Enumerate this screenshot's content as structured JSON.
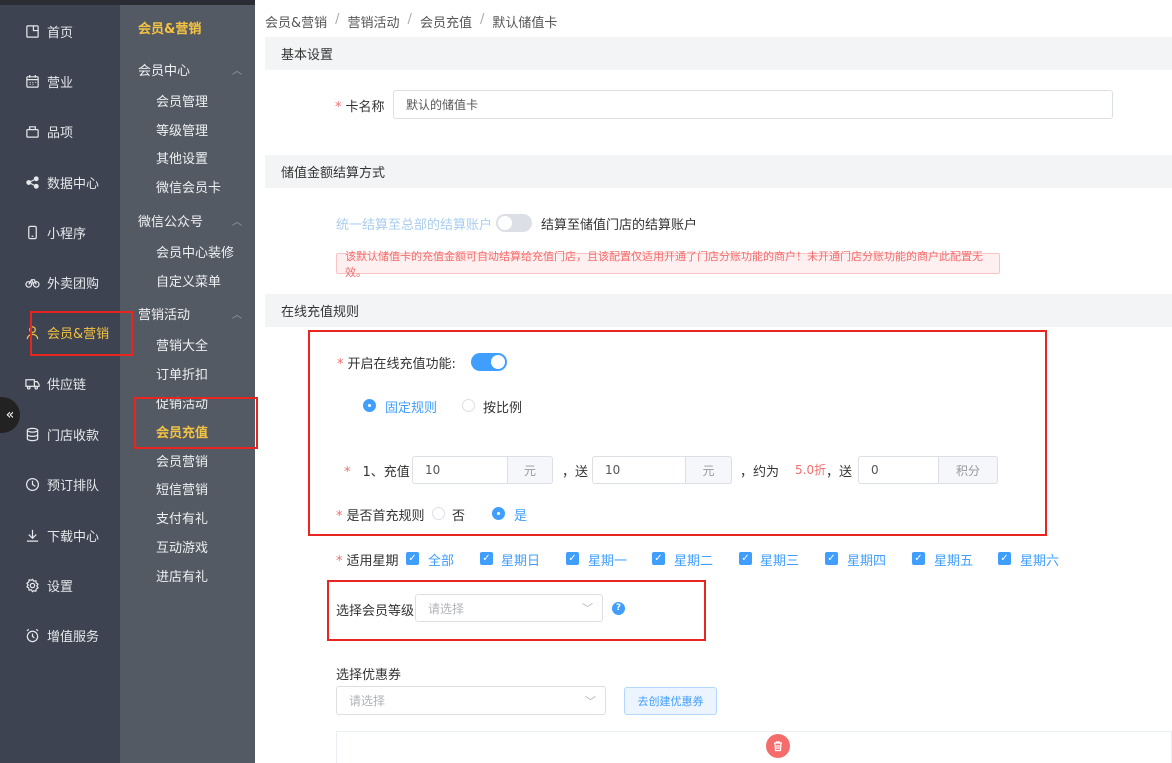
{
  "nav_primary": [
    {
      "label": "首页",
      "icon": "home-icon"
    },
    {
      "label": "营业",
      "icon": "calendar-icon"
    },
    {
      "label": "品项",
      "icon": "bag-icon"
    },
    {
      "label": "数据中心",
      "icon": "share-icon"
    },
    {
      "label": "小程序",
      "icon": "phone-icon"
    },
    {
      "label": "外卖团购",
      "icon": "bike-icon"
    },
    {
      "label": "会员&营销",
      "icon": "user-icon",
      "active": true
    },
    {
      "label": "供应链",
      "icon": "truck-icon"
    },
    {
      "label": "门店收款",
      "icon": "database-icon"
    },
    {
      "label": "预订排队",
      "icon": "clock-icon"
    },
    {
      "label": "下载中心",
      "icon": "download-icon"
    },
    {
      "label": "设置",
      "icon": "gear-icon"
    },
    {
      "label": "增值服务",
      "icon": "alarm-icon"
    }
  ],
  "nav_secondary": {
    "head": "会员&营销",
    "groups": [
      {
        "label": "会员中心",
        "items": [
          "会员管理",
          "等级管理",
          "其他设置",
          "微信会员卡"
        ]
      },
      {
        "label": "微信公众号",
        "items": [
          "会员中心装修",
          "自定义菜单"
        ]
      },
      {
        "label": "营销活动",
        "items": [
          "营销大全",
          "订单折扣",
          "促销活动",
          "会员充值",
          "会员营销",
          "短信营销",
          "支付有礼",
          "互动游戏",
          "进店有礼"
        ]
      }
    ]
  },
  "breadcrumb": [
    "会员&营销",
    "营销活动",
    "会员充值",
    "默认储值卡"
  ],
  "sections": {
    "basic": "基本设置",
    "settle": "储值金额结算方式",
    "online": "在线充值规则"
  },
  "card_name": {
    "label": "卡名称",
    "value": "默认的储值卡"
  },
  "settle": {
    "left": "统一结算至总部的结算账户",
    "right": "结算至储值门店的结算账户",
    "alert": "该默认储值卡的充值金额可自动结算给充值门店，且该配置仅适用开通了门店分账功能的商户！未开通门店分账功能的商户此配置无效。"
  },
  "online": {
    "enable_label": "开启在线充值功能:",
    "mode_fixed": "固定规则",
    "mode_ratio": "按比例",
    "rule_prefix": "1、充值",
    "recharge": "10",
    "unit_yuan": "元",
    "give_label": "，送",
    "give": "10",
    "approx_label": "，约为",
    "discount": "5.0折",
    "give2_label": "，送",
    "points": "0",
    "unit_points": "积分",
    "first_label": "是否首充规则",
    "no": "否",
    "yes": "是"
  },
  "weekdays": {
    "label": "适用星期",
    "items": [
      "全部",
      "星期日",
      "星期一",
      "星期二",
      "星期三",
      "星期四",
      "星期五",
      "星期六"
    ]
  },
  "member_level": {
    "label": "选择会员等级",
    "placeholder": "请选择"
  },
  "coupon": {
    "label": "选择优惠券",
    "placeholder": "请选择",
    "create_btn": "去创建优惠券"
  },
  "colors": {
    "accent": "#409eff",
    "active_nav": "#f5c342",
    "danger": "#f56c6c",
    "highlight_box": "#e8261f"
  }
}
